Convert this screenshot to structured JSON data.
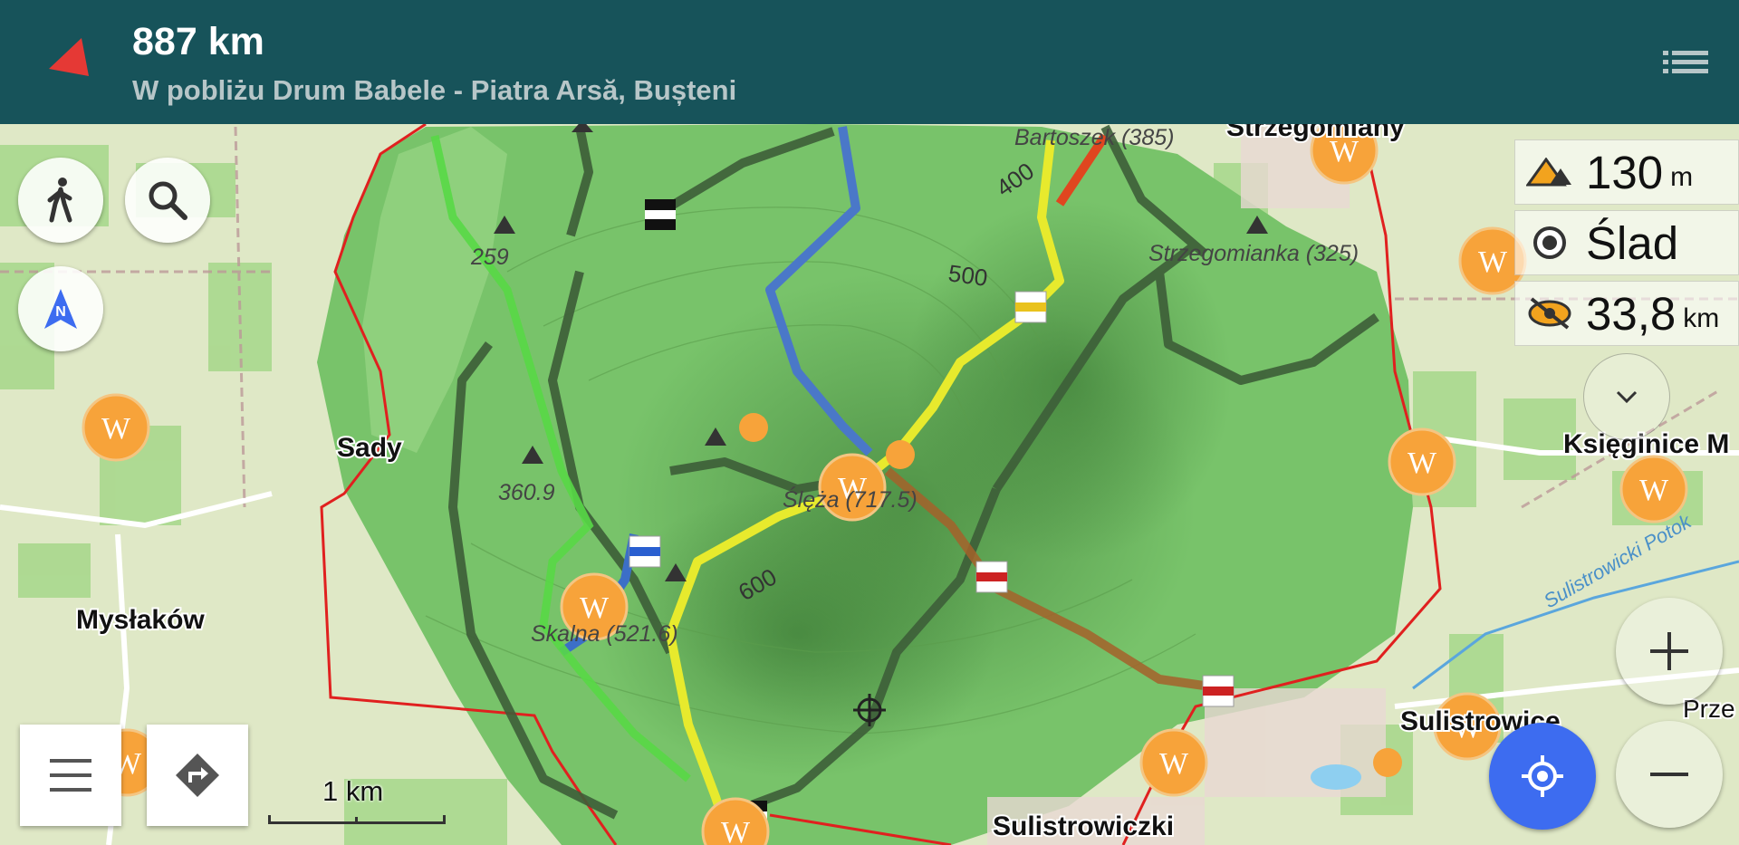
{
  "topbar": {
    "distance": "887 km",
    "near_text": "W pobliżu Drum Babele - Piatra Arsă, Bușteni",
    "arrow_color": "#e53935"
  },
  "widgets": {
    "altitude": {
      "value": "130",
      "unit": "m",
      "icon": "elevation-icon"
    },
    "track": {
      "value": "Ślad",
      "icon": "record-icon"
    },
    "distance": {
      "value": "33,8",
      "unit": "km",
      "icon": "eye-off-icon"
    }
  },
  "scale": {
    "label": "1 km"
  },
  "map_labels": {
    "sady": "Sady",
    "myslakow": "Mysłaków",
    "sulistrowiczki": "Sulistrowiczki",
    "sulistrowice": "Sulistrowice",
    "ksieginice": "Księginice M",
    "strzegomiany": "Strzegomiany",
    "strzegomianka": "Strzegomianka (325)",
    "bartoszek": "Bartoszek (385)",
    "sleza": "Ślęża (717.5)",
    "skalna": "Skalna (521.6)",
    "peak_259": "259",
    "peak_360": "360.9",
    "contour_400": "400",
    "contour_500": "500",
    "contour_600": "600",
    "stream": "Sulistrowicki Potok",
    "prze": "Prze"
  },
  "colors": {
    "topbar_bg": "#17535a",
    "boundary": "#e0201f",
    "wiki_marker": "#f7a33a",
    "location_button": "#3d6cf0"
  }
}
